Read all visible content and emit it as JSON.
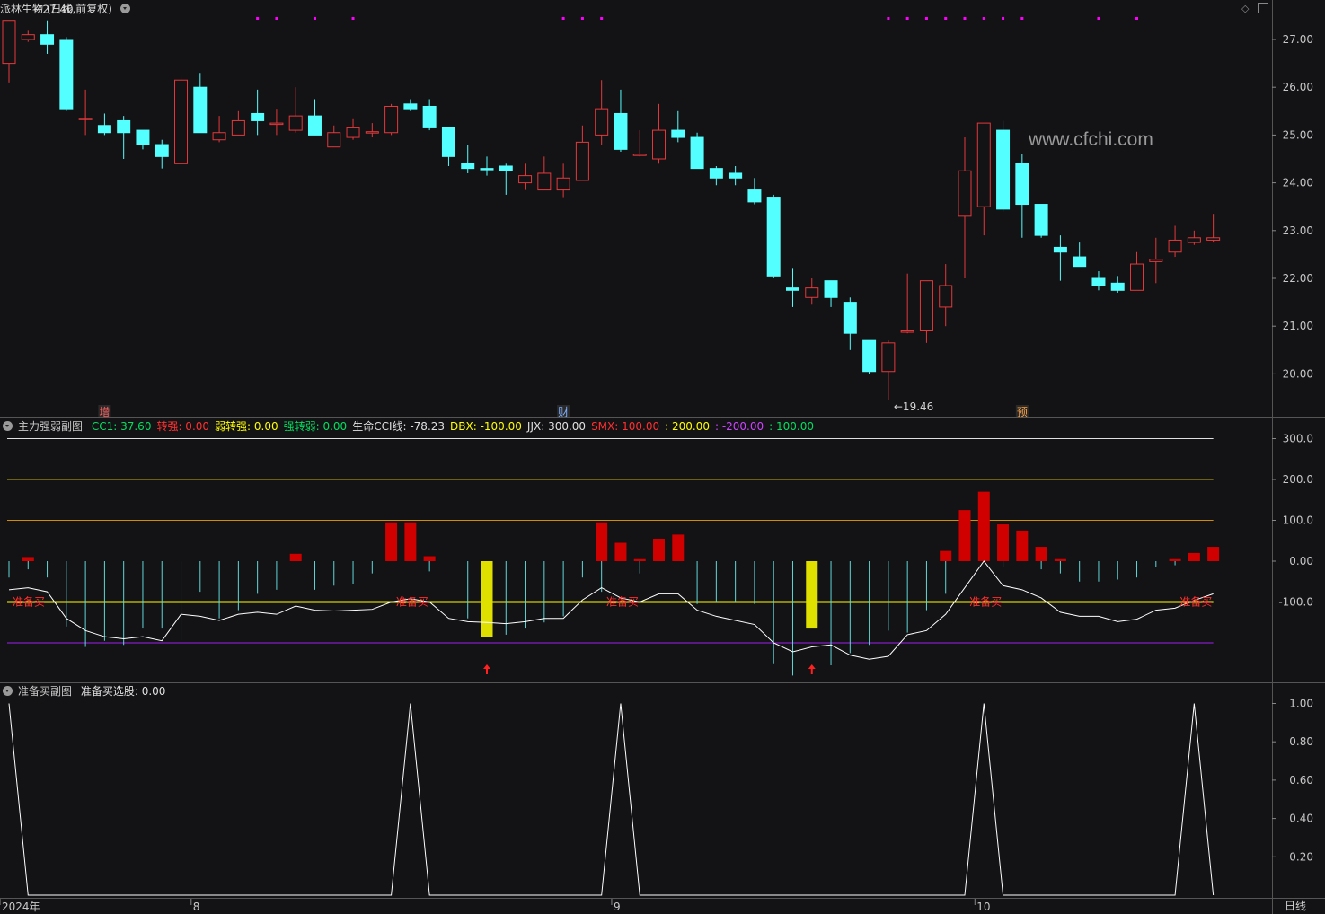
{
  "title": "派林生物 (日线,前复权)",
  "watermark": "www.cfchi.com",
  "corner_icons": [
    "diamond-icon",
    "restore-icon"
  ],
  "bottom_label": "日线",
  "colors": {
    "bg": "#131215",
    "up": "#e3393b",
    "down": "#54ffff",
    "grid": "#3a3a3a",
    "axis_text": "#c8c8c8",
    "magenta": "#ff00ff",
    "yellow": "#ffff00",
    "orange": "#ff9b00"
  },
  "panel2": {
    "name": "主力强弱副图",
    "fields": [
      {
        "label": "CC1: 37.60",
        "color": "#00e060"
      },
      {
        "label": "转强: 0.00",
        "color": "#ff3030"
      },
      {
        "label": "弱转强: 0.00",
        "color": "#ffff00"
      },
      {
        "label": "强转弱: 0.00",
        "color": "#00e060"
      },
      {
        "label": "生命CCI线: -78.23",
        "color": "#e0e0e0"
      },
      {
        "label": "DBX: -100.00",
        "color": "#ffff00"
      },
      {
        "label": "JJX: 300.00",
        "color": "#e0e0e0"
      },
      {
        "label": "SMX: 100.00",
        "color": "#ff3030"
      },
      {
        "label": ": 200.00",
        "color": "#ffff00"
      },
      {
        "label": ": -200.00",
        "color": "#cc44ff"
      },
      {
        "label": ": 100.00",
        "color": "#00e060"
      }
    ]
  },
  "panel3": {
    "name": "准备买副图",
    "fields": [
      {
        "label": "准备买选股: 0.00",
        "color": "#e0e0e0"
      }
    ]
  },
  "chart_data": [
    {
      "type": "candlestick",
      "title": "派林生物 (日线,前复权)",
      "ylim": [
        19.2,
        27.6
      ],
      "y_ticks": [
        "27.00",
        "26.00",
        "25.00",
        "24.00",
        "23.00",
        "22.00",
        "21.00",
        "20.00"
      ],
      "x_ticks": [
        {
          "index": 0,
          "label": "2024年"
        },
        {
          "index": 10,
          "label": "8"
        },
        {
          "index": 32,
          "label": "9"
        },
        {
          "index": 51,
          "label": "10"
        }
      ],
      "annotations": [
        {
          "index": 1,
          "label": "27.40",
          "price": 27.4
        },
        {
          "index": 46,
          "label": "19.46",
          "price": 19.46
        }
      ],
      "event_markers": [
        {
          "index": 5,
          "label": "增"
        },
        {
          "index": 29,
          "label": "财"
        },
        {
          "index": 53,
          "label": "预"
        }
      ],
      "magenta_dots": [
        13,
        14,
        16,
        18,
        29,
        30,
        31,
        46,
        47,
        48,
        49,
        50,
        51,
        52,
        53,
        57,
        59
      ],
      "candles": [
        {
          "o": 26.5,
          "h": 27.4,
          "l": 26.1,
          "c": 27.4
        },
        {
          "o": 27.0,
          "h": 27.2,
          "l": 26.95,
          "c": 27.1
        },
        {
          "o": 27.1,
          "h": 27.4,
          "l": 26.7,
          "c": 26.9
        },
        {
          "o": 27.0,
          "h": 27.05,
          "l": 25.5,
          "c": 25.55
        },
        {
          "o": 25.35,
          "h": 25.95,
          "l": 25.0,
          "c": 25.35
        },
        {
          "o": 25.2,
          "h": 25.45,
          "l": 25.0,
          "c": 25.05
        },
        {
          "o": 25.3,
          "h": 25.4,
          "l": 24.5,
          "c": 25.05
        },
        {
          "o": 25.1,
          "h": 25.1,
          "l": 24.7,
          "c": 24.8
        },
        {
          "o": 24.8,
          "h": 24.9,
          "l": 24.3,
          "c": 24.55
        },
        {
          "o": 24.4,
          "h": 26.25,
          "l": 24.35,
          "c": 26.15
        },
        {
          "o": 26.0,
          "h": 26.3,
          "l": 25.05,
          "c": 25.05
        },
        {
          "o": 24.9,
          "h": 25.4,
          "l": 24.85,
          "c": 25.05
        },
        {
          "o": 25.0,
          "h": 25.5,
          "l": 25.0,
          "c": 25.3
        },
        {
          "o": 25.45,
          "h": 25.95,
          "l": 25.0,
          "c": 25.3
        },
        {
          "o": 25.25,
          "h": 25.55,
          "l": 25.0,
          "c": 25.25
        },
        {
          "o": 25.1,
          "h": 26.0,
          "l": 25.05,
          "c": 25.4
        },
        {
          "o": 25.4,
          "h": 25.75,
          "l": 25.0,
          "c": 25.0
        },
        {
          "o": 24.75,
          "h": 25.2,
          "l": 24.75,
          "c": 25.05
        },
        {
          "o": 24.95,
          "h": 25.35,
          "l": 24.9,
          "c": 25.15
        },
        {
          "o": 25.05,
          "h": 25.25,
          "l": 24.95,
          "c": 25.07
        },
        {
          "o": 25.05,
          "h": 25.65,
          "l": 25.0,
          "c": 25.6
        },
        {
          "o": 25.65,
          "h": 25.75,
          "l": 25.5,
          "c": 25.55
        },
        {
          "o": 25.6,
          "h": 25.75,
          "l": 25.1,
          "c": 25.15
        },
        {
          "o": 25.15,
          "h": 25.15,
          "l": 24.35,
          "c": 24.55
        },
        {
          "o": 24.4,
          "h": 24.8,
          "l": 24.2,
          "c": 24.3
        },
        {
          "o": 24.3,
          "h": 24.55,
          "l": 24.15,
          "c": 24.28
        },
        {
          "o": 24.35,
          "h": 24.4,
          "l": 23.75,
          "c": 24.25
        },
        {
          "o": 24.0,
          "h": 24.4,
          "l": 23.85,
          "c": 24.15
        },
        {
          "o": 23.85,
          "h": 24.55,
          "l": 23.85,
          "c": 24.2
        },
        {
          "o": 23.85,
          "h": 24.4,
          "l": 23.7,
          "c": 24.1
        },
        {
          "o": 24.05,
          "h": 25.2,
          "l": 24.05,
          "c": 24.85
        },
        {
          "o": 25.0,
          "h": 26.15,
          "l": 24.8,
          "c": 25.55
        },
        {
          "o": 25.45,
          "h": 25.95,
          "l": 24.65,
          "c": 24.7
        },
        {
          "o": 24.6,
          "h": 25.1,
          "l": 24.55,
          "c": 24.6
        },
        {
          "o": 24.5,
          "h": 25.65,
          "l": 24.4,
          "c": 25.1
        },
        {
          "o": 25.1,
          "h": 25.5,
          "l": 24.85,
          "c": 24.95
        },
        {
          "o": 24.95,
          "h": 25.05,
          "l": 24.3,
          "c": 24.3
        },
        {
          "o": 24.3,
          "h": 24.35,
          "l": 23.95,
          "c": 24.1
        },
        {
          "o": 24.2,
          "h": 24.35,
          "l": 23.95,
          "c": 24.1
        },
        {
          "o": 23.85,
          "h": 24.1,
          "l": 23.55,
          "c": 23.6
        },
        {
          "o": 23.7,
          "h": 23.75,
          "l": 22.0,
          "c": 22.05
        },
        {
          "o": 21.8,
          "h": 22.2,
          "l": 21.4,
          "c": 21.75
        },
        {
          "o": 21.6,
          "h": 22.0,
          "l": 21.45,
          "c": 21.8
        },
        {
          "o": 21.95,
          "h": 21.95,
          "l": 21.4,
          "c": 21.6
        },
        {
          "o": 21.5,
          "h": 21.6,
          "l": 20.5,
          "c": 20.85
        },
        {
          "o": 20.7,
          "h": 20.7,
          "l": 20.0,
          "c": 20.05
        },
        {
          "o": 20.05,
          "h": 20.7,
          "l": 19.46,
          "c": 20.65
        },
        {
          "o": 20.9,
          "h": 22.1,
          "l": 20.85,
          "c": 20.9
        },
        {
          "o": 20.9,
          "h": 21.95,
          "l": 20.65,
          "c": 21.95
        },
        {
          "o": 21.4,
          "h": 22.3,
          "l": 21.0,
          "c": 21.85
        },
        {
          "o": 23.3,
          "h": 24.95,
          "l": 22.0,
          "c": 24.25
        },
        {
          "o": 23.5,
          "h": 24.25,
          "l": 22.9,
          "c": 25.25
        },
        {
          "o": 25.1,
          "h": 25.3,
          "l": 23.4,
          "c": 23.45
        },
        {
          "o": 24.4,
          "h": 24.6,
          "l": 22.85,
          "c": 23.55
        },
        {
          "o": 23.55,
          "h": 23.55,
          "l": 22.85,
          "c": 22.9
        },
        {
          "o": 22.65,
          "h": 22.9,
          "l": 21.95,
          "c": 22.55
        },
        {
          "o": 22.45,
          "h": 22.75,
          "l": 22.25,
          "c": 22.25
        },
        {
          "o": 22.0,
          "h": 22.15,
          "l": 21.75,
          "c": 21.85
        },
        {
          "o": 21.9,
          "h": 22.05,
          "l": 21.7,
          "c": 21.75
        },
        {
          "o": 21.75,
          "h": 22.55,
          "l": 21.75,
          "c": 22.3
        },
        {
          "o": 22.35,
          "h": 22.85,
          "l": 21.9,
          "c": 22.4
        },
        {
          "o": 22.55,
          "h": 23.1,
          "l": 22.45,
          "c": 22.8
        },
        {
          "o": 22.75,
          "h": 23.0,
          "l": 22.7,
          "c": 22.85
        },
        {
          "o": 22.8,
          "h": 23.35,
          "l": 22.75,
          "c": 22.85
        }
      ]
    },
    {
      "type": "bar+line",
      "title": "主力强弱副图",
      "ylim": [
        -280,
        330
      ],
      "y_ticks": [
        "300.0",
        "200.0",
        "100.0",
        "0.00",
        "-100.0"
      ],
      "hlines": [
        {
          "value": 300,
          "color": "#e0e0e0"
        },
        {
          "value": 200,
          "color": "#c8b400"
        },
        {
          "value": 100,
          "color": "#d28c00"
        },
        {
          "value": -100,
          "color": "#ffff00"
        },
        {
          "value": -200,
          "color": "#a020f0"
        }
      ],
      "red_bars": [
        [
          1,
          10
        ],
        [
          15,
          18
        ],
        [
          20,
          95
        ],
        [
          21,
          95
        ],
        [
          22,
          12
        ],
        [
          31,
          95
        ],
        [
          32,
          45
        ],
        [
          33,
          5
        ],
        [
          34,
          55
        ],
        [
          35,
          65
        ],
        [
          49,
          25
        ],
        [
          50,
          125
        ],
        [
          51,
          170
        ],
        [
          52,
          90
        ],
        [
          53,
          75
        ],
        [
          54,
          35
        ],
        [
          55,
          5
        ],
        [
          61,
          5
        ],
        [
          62,
          20
        ],
        [
          63,
          35
        ]
      ],
      "yellow_bars": [
        [
          25,
          -185
        ],
        [
          42,
          -165
        ]
      ],
      "cyan_bars": [
        [
          0,
          -40
        ],
        [
          1,
          -20
        ],
        [
          2,
          -40
        ],
        [
          3,
          -160
        ],
        [
          4,
          -210
        ],
        [
          5,
          -195
        ],
        [
          6,
          -205
        ],
        [
          7,
          -165
        ],
        [
          8,
          -165
        ],
        [
          9,
          -195
        ],
        [
          10,
          -75
        ],
        [
          11,
          -140
        ],
        [
          12,
          -120
        ],
        [
          13,
          -80
        ],
        [
          14,
          -70
        ],
        [
          16,
          -70
        ],
        [
          17,
          -60
        ],
        [
          18,
          -55
        ],
        [
          19,
          -30
        ],
        [
          22,
          -25
        ],
        [
          24,
          -140
        ],
        [
          26,
          -180
        ],
        [
          27,
          -165
        ],
        [
          28,
          -150
        ],
        [
          29,
          -135
        ],
        [
          30,
          -40
        ],
        [
          31,
          -75
        ],
        [
          33,
          -30
        ],
        [
          36,
          -105
        ],
        [
          37,
          -100
        ],
        [
          38,
          -100
        ],
        [
          39,
          -105
        ],
        [
          40,
          -250
        ],
        [
          41,
          -280
        ],
        [
          43,
          -255
        ],
        [
          44,
          -225
        ],
        [
          45,
          -205
        ],
        [
          46,
          -170
        ],
        [
          47,
          -175
        ],
        [
          48,
          -120
        ],
        [
          49,
          -80
        ],
        [
          52,
          -15
        ],
        [
          54,
          -20
        ],
        [
          55,
          -30
        ],
        [
          56,
          -50
        ],
        [
          57,
          -50
        ],
        [
          58,
          -45
        ],
        [
          59,
          -40
        ],
        [
          60,
          -15
        ],
        [
          61,
          -10
        ]
      ],
      "cci_line": [
        -70,
        -65,
        -75,
        -140,
        -170,
        -185,
        -190,
        -185,
        -195,
        -130,
        -135,
        -145,
        -130,
        -125,
        -130,
        -110,
        -120,
        -122,
        -120,
        -118,
        -100,
        -92,
        -100,
        -140,
        -148,
        -150,
        -153,
        -148,
        -140,
        -140,
        -95,
        -65,
        -90,
        -100,
        -80,
        -80,
        -120,
        -135,
        -145,
        -155,
        -200,
        -222,
        -210,
        -205,
        -230,
        -240,
        -233,
        -180,
        -170,
        -130,
        -65,
        0,
        -60,
        -70,
        -90,
        -125,
        -135,
        -135,
        -148,
        -142,
        -120,
        -115,
        -96,
        -80
      ],
      "buy_labels": [
        0,
        21,
        32,
        51,
        62
      ],
      "buy_label_text": "准备买",
      "arrows": [
        25,
        42
      ]
    },
    {
      "type": "line",
      "title": "准备买副图",
      "ylim": [
        0,
        1.05
      ],
      "y_ticks": [
        "1.00",
        "0.80",
        "0.60",
        "0.40",
        "0.20"
      ],
      "values": [
        1,
        0,
        0,
        0,
        0,
        0,
        0,
        0,
        0,
        0,
        0,
        0,
        0,
        0,
        0,
        0,
        0,
        0,
        0,
        0,
        0,
        1,
        0,
        0,
        0,
        0,
        0,
        0,
        0,
        0,
        0,
        0,
        1,
        0,
        0,
        0,
        0,
        0,
        0,
        0,
        0,
        0,
        0,
        0,
        0,
        0,
        0,
        0,
        0,
        0,
        0,
        1,
        0,
        0,
        0,
        0,
        0,
        0,
        0,
        0,
        0,
        0,
        1,
        0
      ]
    }
  ]
}
